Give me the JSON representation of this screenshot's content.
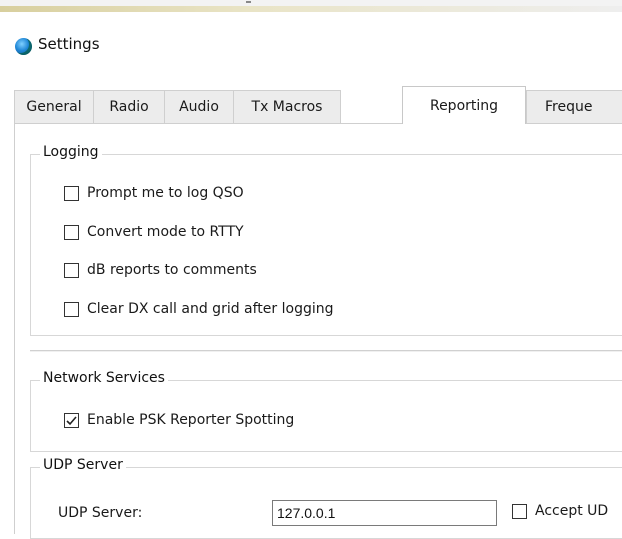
{
  "window": {
    "title": "Settings"
  },
  "tabs": [
    {
      "label": "General",
      "active": false
    },
    {
      "label": "Radio",
      "active": false
    },
    {
      "label": "Audio",
      "active": false
    },
    {
      "label": "Tx Macros",
      "active": false
    },
    {
      "label": "Reporting",
      "active": true
    },
    {
      "label": "Freque",
      "active": false
    }
  ],
  "logging": {
    "legend": "Logging",
    "options": [
      {
        "label": "Prompt me to log QSO",
        "checked": false
      },
      {
        "label": "Convert mode to RTTY",
        "checked": false
      },
      {
        "label": "dB reports to comments",
        "checked": false
      },
      {
        "label": "Clear DX call and grid after logging",
        "checked": false
      }
    ]
  },
  "network": {
    "legend": "Network Services",
    "options": [
      {
        "label": "Enable PSK Reporter Spotting",
        "checked": true
      }
    ]
  },
  "udp": {
    "legend": "UDP Server",
    "server_label": "UDP Server:",
    "server_value": "127.0.0.1",
    "accept_label": "Accept UD",
    "accept_checked": false
  }
}
